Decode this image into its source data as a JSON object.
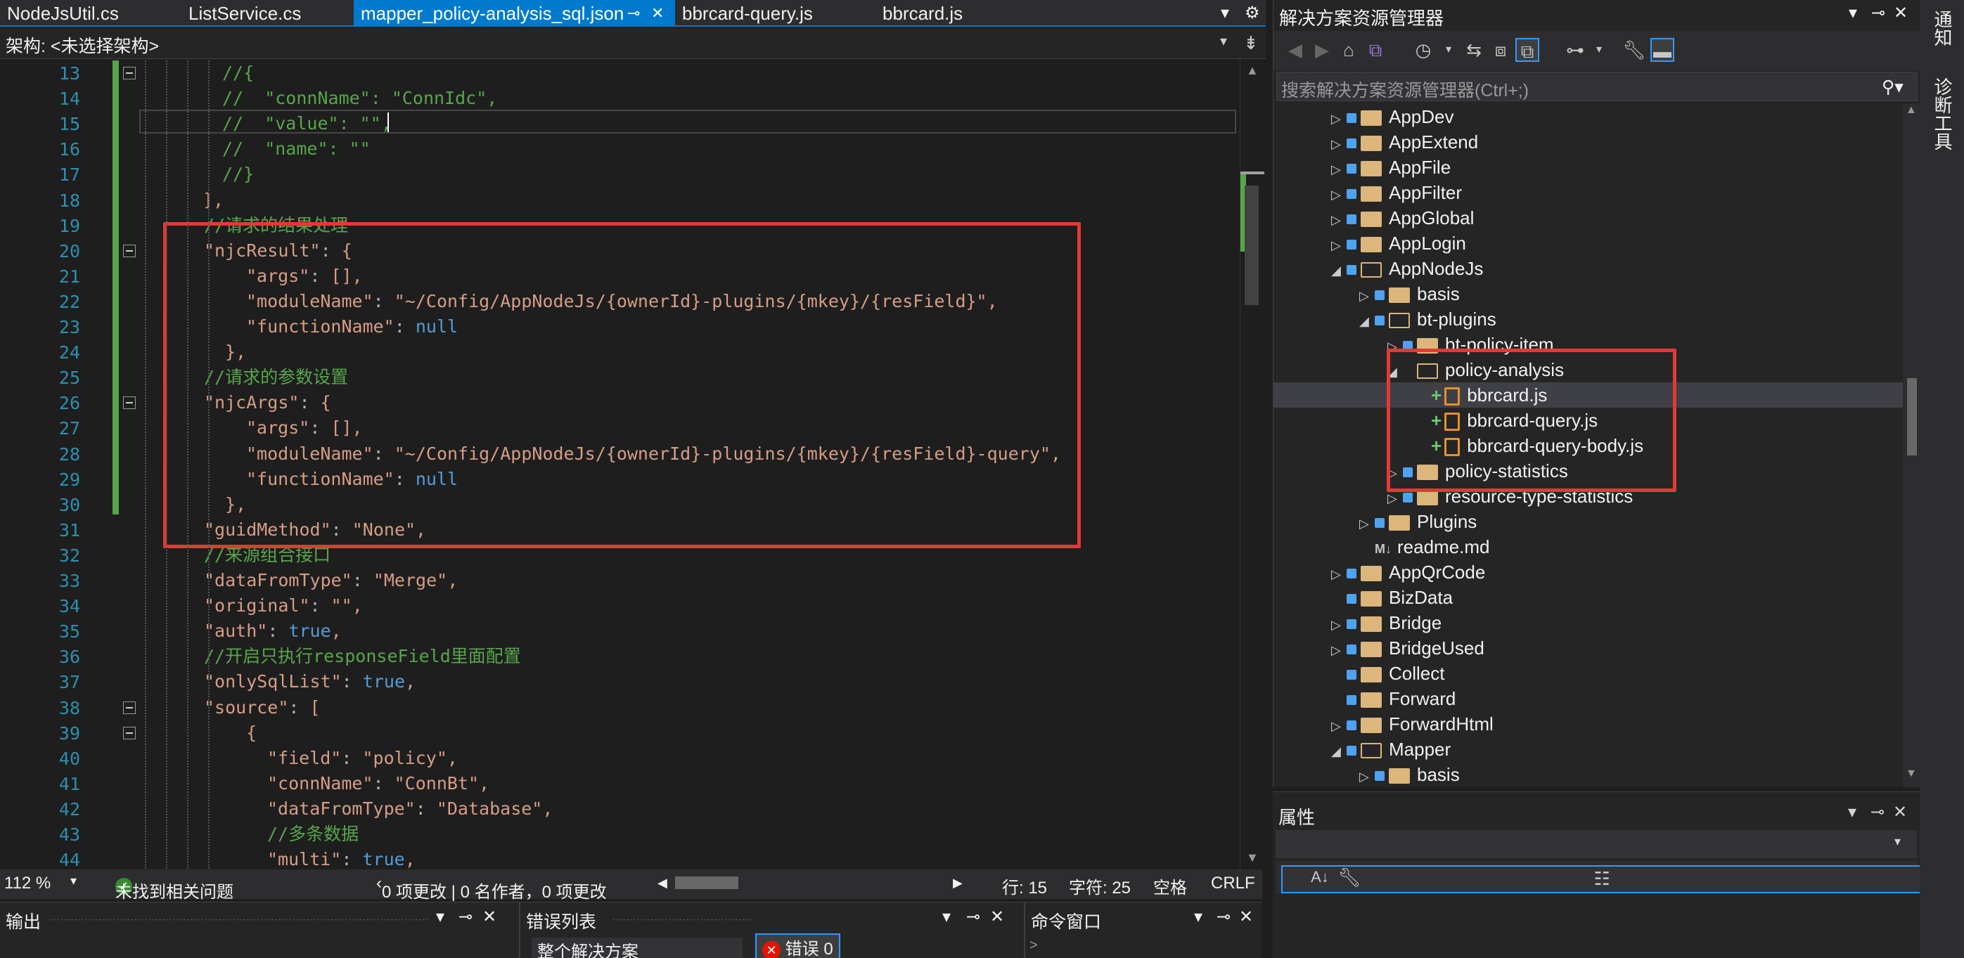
{
  "tabs": [
    {
      "label": "NodeJsUtil.cs",
      "active": false
    },
    {
      "label": "ListService.cs",
      "active": false
    },
    {
      "label": "mapper_policy-analysis_sql.json",
      "active": true
    },
    {
      "label": "bbrcard-query.js",
      "active": false
    },
    {
      "label": "bbrcard.js",
      "active": false
    }
  ],
  "navbar": {
    "label": "架构: <未选择架构>"
  },
  "code": {
    "line_numbers": [
      "13",
      "14",
      "15",
      "16",
      "17",
      "18",
      "19",
      "20",
      "21",
      "22",
      "23",
      "24",
      "25",
      "26",
      "27",
      "28",
      "29",
      "30",
      "31",
      "32",
      "33",
      "34",
      "35",
      "36",
      "37",
      "38",
      "39",
      "40",
      "41",
      "42",
      "43",
      "44"
    ],
    "lines": [
      "//{",
      "//  \"connName\": \"ConnIdc\",",
      "//  \"value\": \"\",",
      "//  \"name\": \"\"",
      "//}",
      "],",
      "//请求的结果处理",
      "\"njcResult\": {",
      "\"args\": [],",
      "\"moduleName\": \"~/Config/AppNodeJs/{ownerId}-plugins/{mkey}/{resField}\",",
      "\"functionName\": null",
      "},",
      "//请求的参数设置",
      "\"njcArgs\": {",
      "\"args\": [],",
      "\"moduleName\": \"~/Config/AppNodeJs/{ownerId}-plugins/{mkey}/{resField}-query\",",
      "\"functionName\": null",
      "},",
      "\"guidMethod\": \"None\",",
      "//来源组合接口",
      "\"dataFromType\": \"Merge\",",
      "\"original\": \"\",",
      "\"auth\": true,",
      "//开启只执行responseField里面配置",
      "\"onlySqlList\": true,",
      "\"source\": [",
      "{",
      "\"field\": \"policy\",",
      "\"connName\": \"ConnBt\",",
      "\"dataFromType\": \"Database\",",
      "//多条数据",
      "\"multi\": true,"
    ]
  },
  "status": {
    "zoom": "112 %",
    "issues": "未找到相关问题",
    "changes": "0 项更改 | 0 名作者，0 项更改",
    "row": "行: 15",
    "col": "字符: 25",
    "spaces": "空格",
    "eol": "CRLF"
  },
  "bottom_panels": {
    "output": "输出",
    "errors": "错误列表",
    "errors_scope": "整个解决方案",
    "errors_count": "错误 0",
    "command": "命令窗口"
  },
  "solution_explorer": {
    "title": "解决方案资源管理器",
    "search_placeholder": "搜索解决方案资源管理器(Ctrl+;)",
    "items": [
      "AppDev",
      "AppExtend",
      "AppFile",
      "AppFilter",
      "AppGlobal",
      "AppLogin",
      "AppNodeJs",
      "basis",
      "bt-plugins",
      "bt-policy-item",
      "policy-analysis",
      "bbrcard.js",
      "bbrcard-query.js",
      "bbrcard-query-body.js",
      "policy-statistics",
      "resource-type-statistics",
      "Plugins",
      "readme.md",
      "AppQrCode",
      "BizData",
      "Bridge",
      "BridgeUsed",
      "Collect",
      "Forward",
      "ForwardHtml",
      "Mapper",
      "basis"
    ]
  },
  "properties": {
    "title": "属性"
  },
  "vertical_tabs": [
    "通知",
    "诊断工具"
  ],
  "colors": {
    "accent": "#007acc",
    "highlight": "#e53935",
    "folder": "#dcb67a"
  }
}
